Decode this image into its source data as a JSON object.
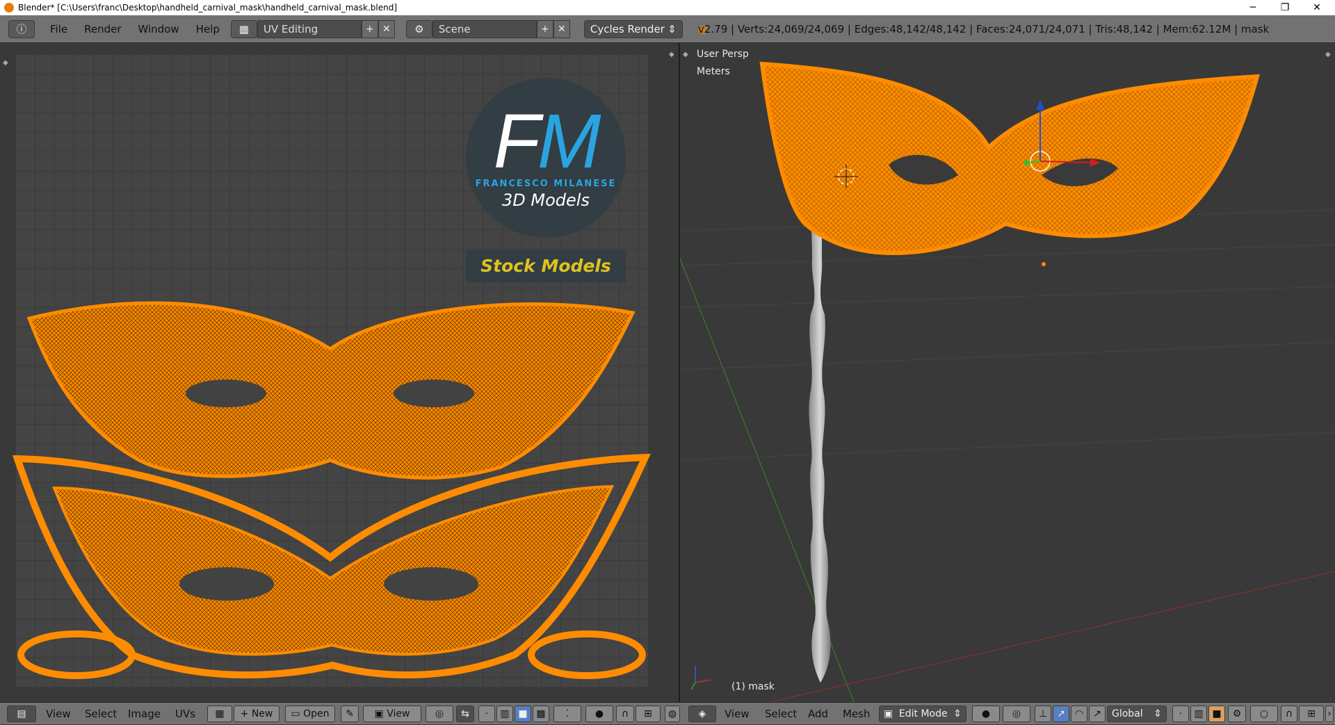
{
  "window": {
    "title": "Blender* [C:\\Users\\franc\\Desktop\\handheld_carnival_mask\\handheld_carnival_mask.blend]",
    "minimize": "─",
    "maximize": "❐",
    "close": "✕"
  },
  "menu": {
    "file": "File",
    "render": "Render",
    "window": "Window",
    "help": "Help"
  },
  "layout": "UV Editing",
  "scene": "Scene",
  "engine": "Cycles Render",
  "stats": "v2.79 | Verts:24,069/24,069 | Edges:48,142/48,142 | Faces:24,071/24,071 | Tris:48,142 | Mem:62.12M | mask",
  "logo": {
    "fm_f": "F",
    "fm_m": "M",
    "name": "FRANCESCO MILANESE",
    "tagline": "3D Models",
    "stock": "Stock Models"
  },
  "viewport": {
    "view": "User Persp",
    "units": "Meters",
    "object": "(1) mask"
  },
  "uv_footer": {
    "view": "View",
    "select": "Select",
    "image": "Image",
    "uvs": "UVs",
    "new": "New",
    "open": "Open",
    "view2": "View"
  },
  "vp_footer": {
    "view": "View",
    "select": "Select",
    "add": "Add",
    "mesh": "Mesh",
    "mode": "Edit Mode",
    "orientation": "Global"
  },
  "colors": {
    "selection": "#ff8c00",
    "background": "#393939",
    "header": "#727272"
  }
}
